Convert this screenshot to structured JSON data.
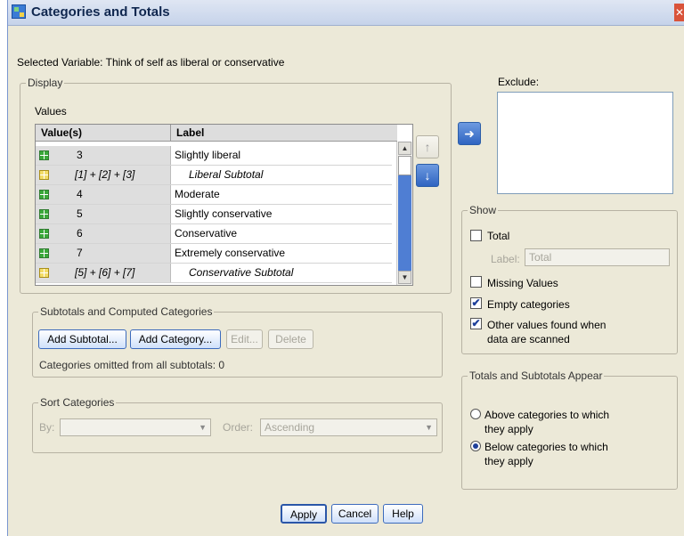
{
  "window": {
    "title": "Categories and Totals",
    "close_label": "✕"
  },
  "selected_variable": "Selected Variable: Think of self as liberal or conservative",
  "display": {
    "group_label": "Display",
    "values_label": "Values",
    "columns": {
      "value": "Value(s)",
      "label": "Label"
    },
    "rows": [
      {
        "value": "3",
        "label": "Slightly liberal",
        "type": "category"
      },
      {
        "value": "[1] + [2] + [3]",
        "label": "Liberal Subtotal",
        "type": "subtotal"
      },
      {
        "value": "4",
        "label": "Moderate",
        "type": "category"
      },
      {
        "value": "5",
        "label": "Slightly conservative",
        "type": "category"
      },
      {
        "value": "6",
        "label": "Conservative",
        "type": "category"
      },
      {
        "value": "7",
        "label": "Extremely conservative",
        "type": "category"
      },
      {
        "value": "[5] + [6] + [7]",
        "label": "Conservative Subtotal",
        "type": "subtotal"
      }
    ],
    "move_up_icon": "arrow-up-icon",
    "move_down_icon": "arrow-down-icon"
  },
  "exclude": {
    "label": "Exclude:",
    "move_icon": "arrow-right-icon"
  },
  "subtotals": {
    "group_label": "Subtotals and Computed Categories",
    "add_subtotal": "Add Subtotal...",
    "add_category": "Add Category...",
    "edit": "Edit...",
    "delete": "Delete",
    "omitted_text": "Categories omitted from all subtotals: 0"
  },
  "sort": {
    "group_label": "Sort Categories",
    "by_label": "By:",
    "by_value": "",
    "order_label": "Order:",
    "order_value": "Ascending"
  },
  "show": {
    "group_label": "Show",
    "total": {
      "label": "Total",
      "checked": false
    },
    "total_label_caption": "Label:",
    "total_label_value": "Total",
    "missing_values": {
      "label": "Missing Values",
      "checked": false
    },
    "empty_categories": {
      "label": "Empty categories",
      "checked": true
    },
    "other_values": {
      "line1": "Other values found when",
      "line2": "data are scanned",
      "checked": true
    }
  },
  "totals_appear": {
    "group_label": "Totals and Subtotals Appear",
    "above": {
      "line1": "Above categories to which",
      "line2": "they apply",
      "selected": false
    },
    "below": {
      "line1": "Below categories to which",
      "line2": "they apply",
      "selected": true
    }
  },
  "buttons": {
    "apply": "Apply",
    "cancel": "Cancel",
    "help": "Help"
  },
  "colors": {
    "accent": "#3c6bbd",
    "scroll_track": "#4f7ed3",
    "dialog_bg": "#ece9d8"
  }
}
